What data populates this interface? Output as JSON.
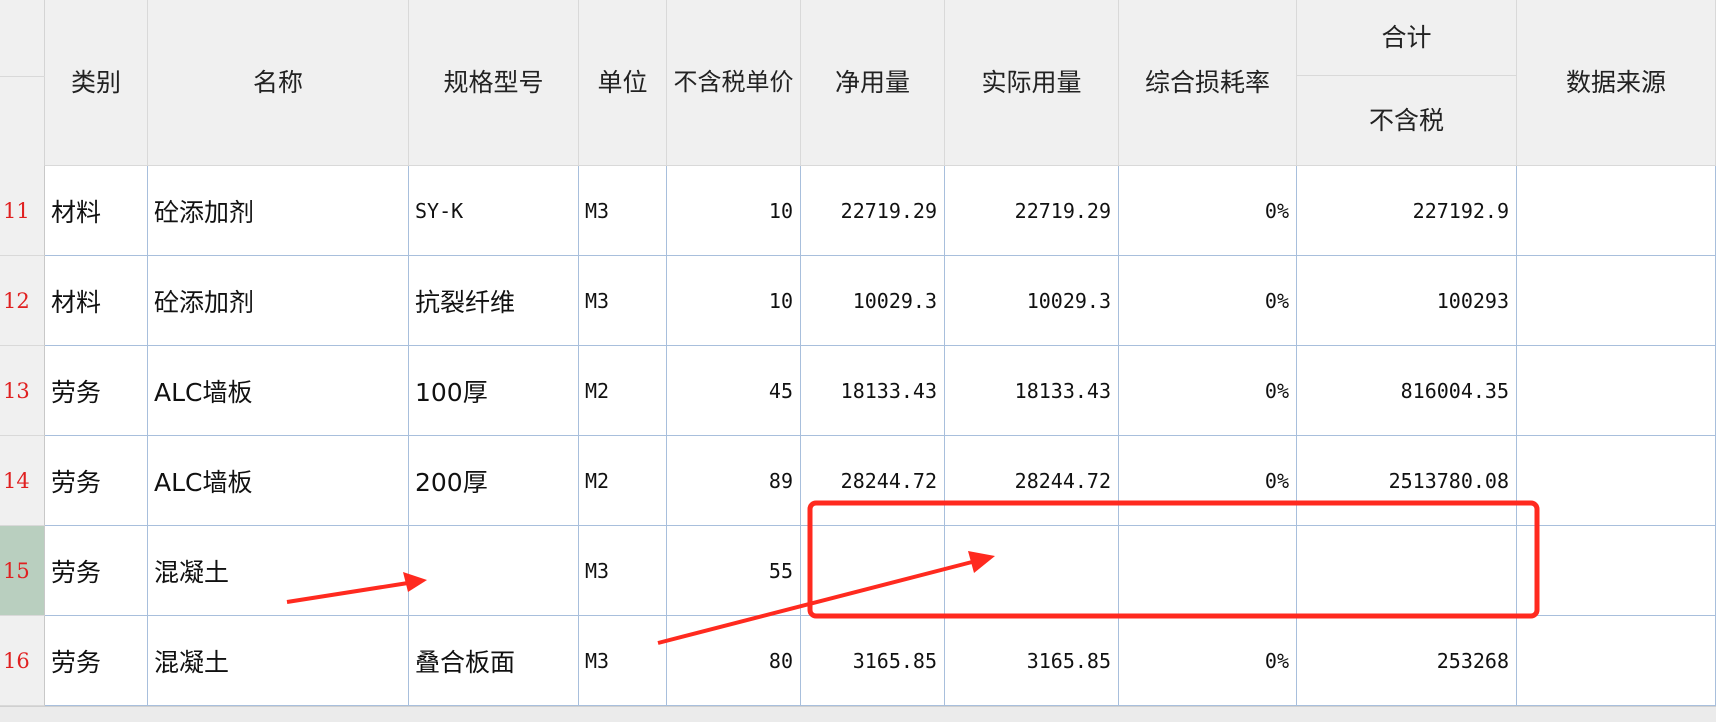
{
  "headers": {
    "category": "类别",
    "name": "名称",
    "spec": "规格型号",
    "unit": "单位",
    "price_excl_tax": "不含税单价",
    "net_qty": "净用量",
    "actual_qty": "实际用量",
    "loss_rate": "综合损耗率",
    "total_group": "合计",
    "total_excl_tax": "不含税",
    "data_source": "数据来源"
  },
  "rows": [
    {
      "no": "11",
      "category": "材料",
      "name": "砼添加剂",
      "spec": "SY-K",
      "unit": "M3",
      "price": "10",
      "net": "22719.29",
      "actual": "22719.29",
      "loss": "0%",
      "total": "227192.9",
      "source": ""
    },
    {
      "no": "12",
      "category": "材料",
      "name": "砼添加剂",
      "spec": "抗裂纤维",
      "unit": "M3",
      "price": "10",
      "net": "10029.3",
      "actual": "10029.3",
      "loss": "0%",
      "total": "100293",
      "source": ""
    },
    {
      "no": "13",
      "category": "劳务",
      "name": "ALC墙板",
      "spec": "100厚",
      "unit": "M2",
      "price": "45",
      "net": "18133.43",
      "actual": "18133.43",
      "loss": "0%",
      "total": "816004.35",
      "source": ""
    },
    {
      "no": "14",
      "category": "劳务",
      "name": "ALC墙板",
      "spec": "200厚",
      "unit": "M2",
      "price": "89",
      "net": "28244.72",
      "actual": "28244.72",
      "loss": "0%",
      "total": "2513780.08",
      "source": ""
    },
    {
      "no": "15",
      "category": "劳务",
      "name": "混凝土",
      "spec": "",
      "unit": "M3",
      "price": "55",
      "net": "",
      "actual": "",
      "loss": "",
      "total": "",
      "source": "",
      "selected": true
    },
    {
      "no": "16",
      "category": "劳务",
      "name": "混凝土",
      "spec": "叠合板面",
      "unit": "M3",
      "price": "80",
      "net": "3165.85",
      "actual": "3165.85",
      "loss": "0%",
      "total": "253268",
      "source": ""
    }
  ],
  "annotation_color": "#ff2a1f"
}
